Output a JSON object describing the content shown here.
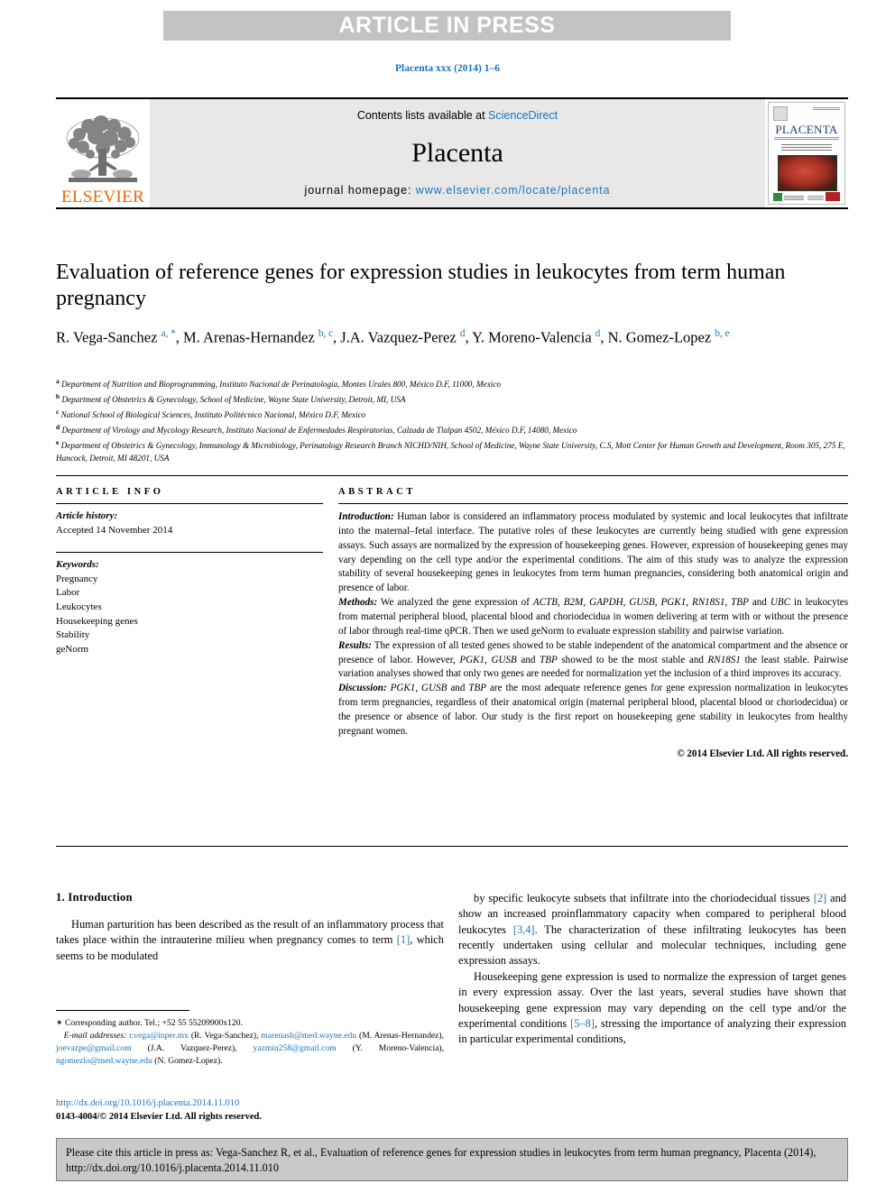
{
  "banner": {
    "text": "ARTICLE IN PRESS"
  },
  "running_head": "Placenta xxx (2014) 1–6",
  "masthead": {
    "publisher_logo_label": "ELSEVIER",
    "contents_prefix": "Contents lists available at ",
    "contents_link": "ScienceDirect",
    "journal_name": "Placenta",
    "homepage_prefix": "journal homepage: ",
    "homepage_url": "www.elsevier.com/locate/placenta",
    "cover_title": "PLACENTA"
  },
  "article": {
    "title": "Evaluation of reference genes for expression studies in leukocytes from term human pregnancy",
    "authors_html": "R. Vega-Sanchez <sup class=\"aff-mark\">a, *</sup>, M. Arenas-Hernandez <sup class=\"aff-mark\">b, c</sup>, J.A. Vazquez-Perez <sup class=\"aff-mark\">d</sup>, Y. Moreno-Valencia <sup class=\"aff-mark\">d</sup>, N. Gomez-Lopez <sup class=\"aff-mark\">b, e</sup>",
    "affiliations": [
      {
        "mark": "a",
        "text": "Department of Nutrition and Bioprogramming, Instituto Nacional de Perinatología, Montes Urales 800, México D.F, 11000, Mexico"
      },
      {
        "mark": "b",
        "text": "Department of Obstetrics & Gynecology, School of Medicine, Wayne State University, Detroit, MI, USA"
      },
      {
        "mark": "c",
        "text": "National School of Biological Sciences, Instituto Politécnico Nacional, México D.F, Mexico"
      },
      {
        "mark": "d",
        "text": "Department of Virology and Mycology Research, Instituto Nacional de Enfermedades Respiratorias, Calzada de Tlalpan 4502, México D.F, 14080, Mexico"
      },
      {
        "mark": "e",
        "text": "Department of Obstetrics & Gynecology, Immunology & Microbiology, Perinatology Research Branch NICHD/NIH, School of Medicine, Wayne State University, C.S, Mott Center for Human Growth and Development, Room 305, 275 E, Hancock, Detroit, MI 48201, USA"
      }
    ]
  },
  "article_info": {
    "heading": "ARTICLE INFO",
    "history_label": "Article history:",
    "history_value": "Accepted 14 November 2014",
    "keywords_label": "Keywords:",
    "keywords": [
      "Pregnancy",
      "Labor",
      "Leukocytes",
      "Housekeeping genes",
      "Stability",
      "geNorm"
    ]
  },
  "abstract": {
    "heading": "ABSTRACT",
    "sections": [
      {
        "label": "Introduction:",
        "text": " Human labor is considered an inflammatory process modulated by systemic and local leukocytes that infiltrate into the maternal–fetal interface. The putative roles of these leukocytes are currently being studied with gene expression assays. Such assays are normalized by the expression of housekeeping genes. However, expression of housekeeping genes may vary depending on the cell type and/or the experimental conditions. The aim of this study was to analyze the expression stability of several housekeeping genes in leukocytes from term human pregnancies, considering both anatomical origin and presence of labor."
      },
      {
        "label": "Methods:",
        "text": " We analyzed the gene expression of ACTB, B2M, GAPDH, GUSB, PGK1, RN18S1, TBP and UBC in leukocytes from maternal peripheral blood, placental blood and choriodecidua in women delivering at term with or without the presence of labor through real-time qPCR. Then we used geNorm to evaluate expression stability and pairwise variation."
      },
      {
        "label": "Results:",
        "text": " The expression of all tested genes showed to be stable independent of the anatomical compartment and the absence or presence of labor. However, PGK1, GUSB and TBP showed to be the most stable and RN18S1 the least stable. Pairwise variation analyses showed that only two genes are needed for normalization yet the inclusion of a third improves its accuracy."
      },
      {
        "label": "Discussion:",
        "text": " PGK1, GUSB and TBP are the most adequate reference genes for gene expression normalization in leukocytes from term pregnancies, regardless of their anatomical origin (maternal peripheral blood, placental blood or choriodecidua) or the presence or absence of labor. Our study is the first report on housekeeping gene stability in leukocytes from healthy pregnant women."
      }
    ],
    "copyright": "© 2014 Elsevier Ltd. All rights reserved."
  },
  "introduction": {
    "heading": "1.  Introduction",
    "left_paragraph": "Human parturition has been described as the result of an inflammatory process that takes place within the intrauterine milieu when pregnancy comes to term [1], which seems to be modulated",
    "right_paragraph_1": "by specific leukocyte subsets that infiltrate into the choriodecidual tissues [2] and show an increased proinflammatory capacity when compared to peripheral blood leukocytes [3,4]. The characterization of these infiltrating leukocytes has been recently undertaken using cellular and molecular techniques, including gene expression assays.",
    "right_paragraph_2": "Housekeeping gene expression is used to normalize the expression of target genes in every expression assay. Over the last years, several studies have shown that housekeeping gene expression may vary depending on the cell type and/or the experimental conditions [5–8], stressing the importance of analyzing their expression in particular experimental conditions,"
  },
  "footnote": {
    "corresponding": "Corresponding author. Tel.; +52 55 55209900x120.",
    "email_label": "E-mail addresses:",
    "emails": [
      {
        "address": "r.vega@inper.mx",
        "name": "(R. Vega-Sanchez),"
      },
      {
        "address": "marenash@med.wayne.edu",
        "name": "(M. Arenas-Hernandez),"
      },
      {
        "address": "joevazpe@gmail.com",
        "name": "(J.A. Vazquez-Perez),"
      },
      {
        "address": "yazmin258@gmail.com",
        "name": "(Y. Moreno-Valencia),"
      },
      {
        "address": "ngomezlo@med.wayne.edu",
        "name": "(N. Gomez-Lopez)."
      }
    ]
  },
  "doi_block": {
    "doi_url": "http://dx.doi.org/10.1016/j.placenta.2014.11.010",
    "issn_line": "0143-4004/© 2014 Elsevier Ltd. All rights reserved."
  },
  "cite_box": {
    "text": "Please cite this article in press as: Vega-Sanchez R, et al., Evaluation of reference genes for expression studies in leukocytes from term human pregnancy, Placenta (2014), http://dx.doi.org/10.1016/j.placenta.2014.11.010"
  },
  "colors": {
    "link_blue": "#1b75bc",
    "elsevier_orange": "#ec6608",
    "banner_gray": "#c2c3c5",
    "masthead_gray": "#e8e8e8",
    "cite_gray": "#c9c9c9"
  }
}
